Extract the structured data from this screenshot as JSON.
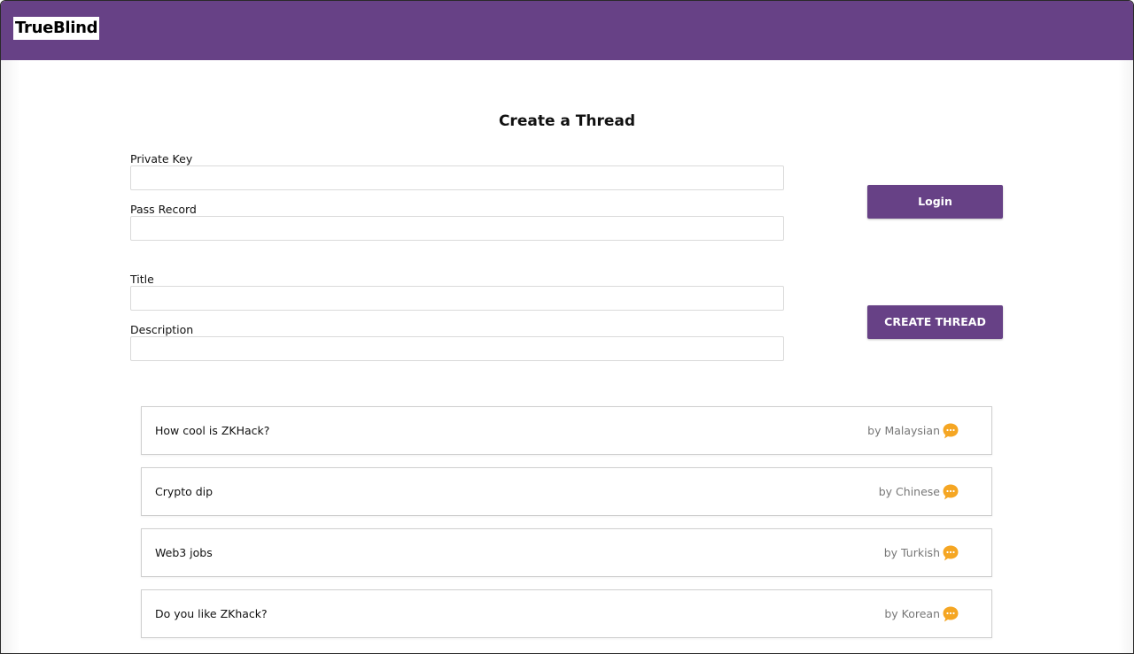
{
  "header": {
    "brand": "TrueBlind"
  },
  "form": {
    "title": "Create a Thread",
    "private_key_label": "Private Key",
    "private_key_value": "",
    "pass_record_label": "Pass Record",
    "pass_record_value": "",
    "title_label": "Title",
    "title_value": "",
    "description_label": "Description",
    "description_value": "",
    "login_label": "Login",
    "create_label": "CREATE THREAD"
  },
  "threads": [
    {
      "title": "How cool is ZKHack?",
      "author": "by Malaysian",
      "icon": "chat-bubble-icon"
    },
    {
      "title": "Crypto dip",
      "author": "by Chinese",
      "icon": "chat-bubble-icon"
    },
    {
      "title": "Web3 jobs",
      "author": "by Turkish",
      "icon": "chat-bubble-icon"
    },
    {
      "title": "Do you like ZKhack?",
      "author": "by Korean",
      "icon": "chat-bubble-icon"
    }
  ],
  "colors": {
    "brand_purple": "#674186",
    "chat_icon_orange": "#f5a623"
  }
}
